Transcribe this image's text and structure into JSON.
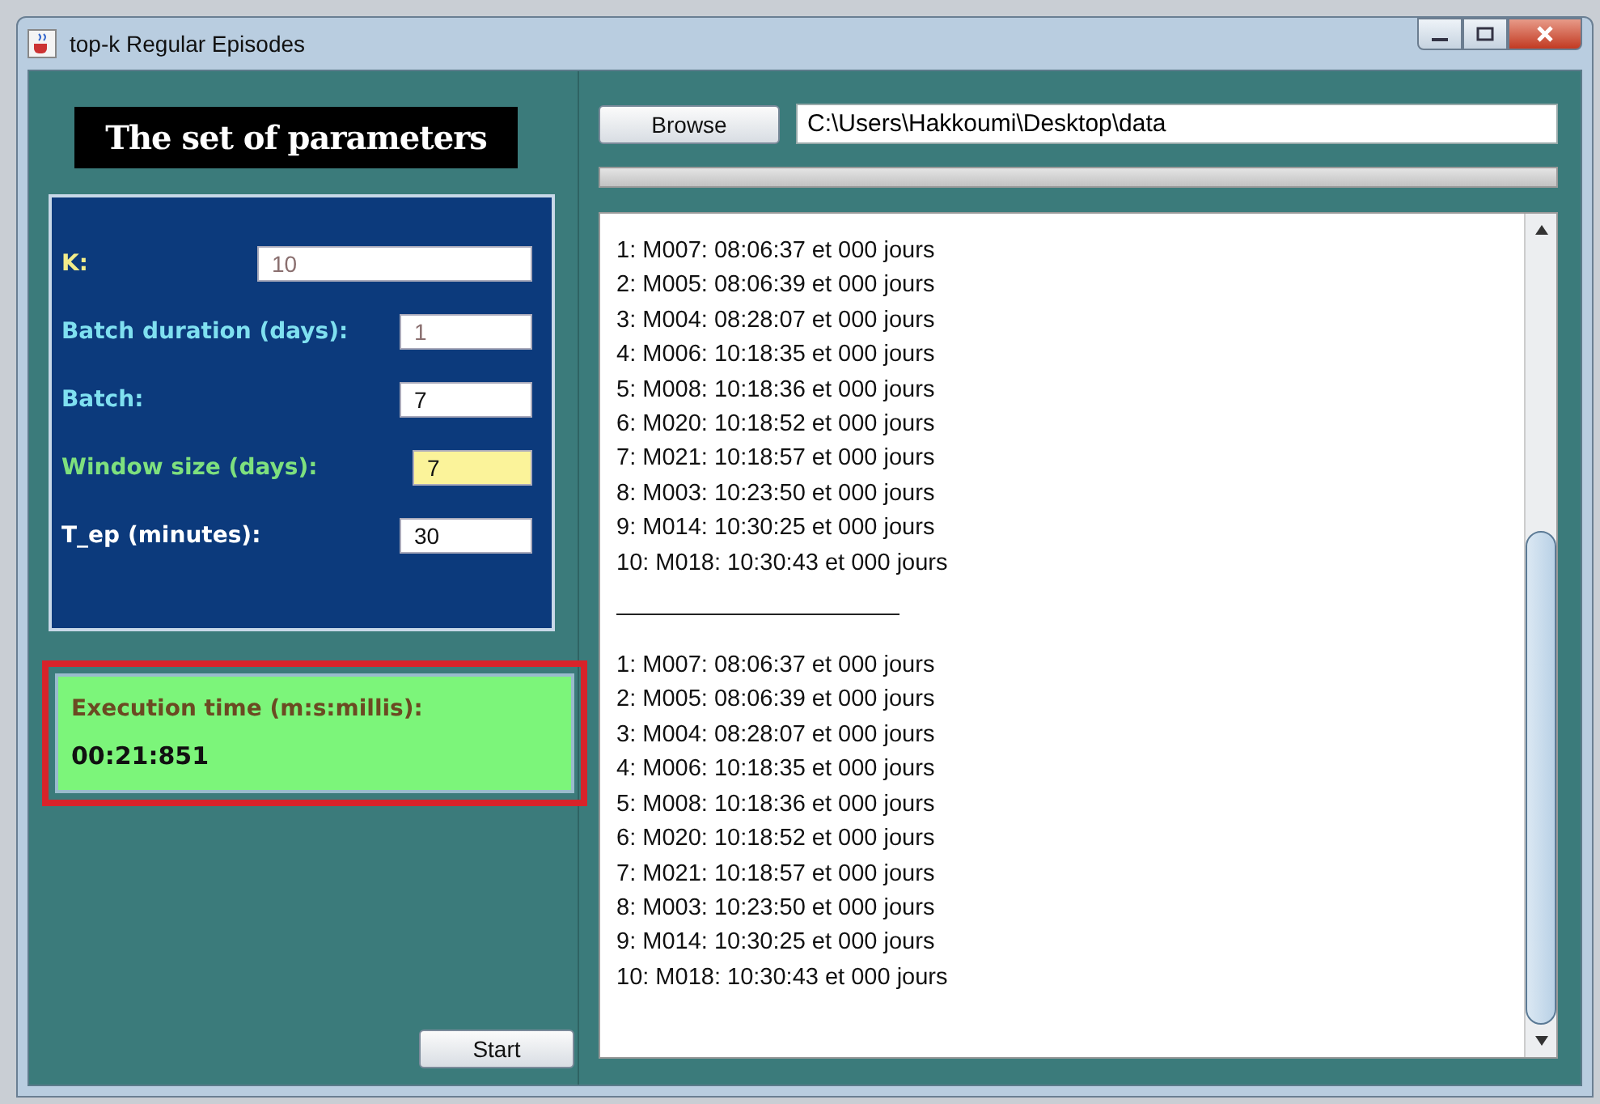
{
  "window": {
    "title": "top-k Regular Episodes"
  },
  "parameters_title": "The set of parameters",
  "parameters": [
    {
      "label": "K:",
      "color": "#f2ec8a",
      "value": "10",
      "disabled": true,
      "highlighted": false
    },
    {
      "label": "Batch duration (days):",
      "color": "#7fe0f0",
      "value": "1",
      "disabled": true,
      "highlighted": false
    },
    {
      "label": "Batch:",
      "color": "#7fe0f0",
      "value": "7",
      "disabled": false,
      "highlighted": false
    },
    {
      "label": "Window size (days):",
      "color": "#7ee07e",
      "value": "7",
      "disabled": false,
      "highlighted": true
    },
    {
      "label": "T_ep (minutes):",
      "color": "#ffffff",
      "value": "30",
      "disabled": false,
      "highlighted": false
    }
  ],
  "execution": {
    "label": "Execution time (m:s:millis):",
    "value": "00:21:851",
    "highlighted": true
  },
  "start_button": "Start",
  "browse_button": "Browse",
  "progress": {
    "level": 1
  },
  "path_field": {
    "value": "C:\\Users\\Hakkoumi\\Desktop\\data"
  },
  "output": [
    {
      "kind": "line",
      "text": "1: M007: 08:06:37 et 000 jours"
    },
    {
      "kind": "line",
      "text": "2: M005: 08:06:39 et 000 jours"
    },
    {
      "kind": "line",
      "text": "3: M004: 08:28:07 et 000 jours"
    },
    {
      "kind": "line",
      "text": "4: M006: 10:18:35 et 000 jours"
    },
    {
      "kind": "line",
      "text": "5: M008: 10:18:36 et 000 jours"
    },
    {
      "kind": "line",
      "text": "6: M020: 10:18:52 et 000 jours"
    },
    {
      "kind": "line",
      "text": "7: M021: 10:18:57 et 000 jours"
    },
    {
      "kind": "line",
      "text": "8: M003: 10:23:50 et 000 jours"
    },
    {
      "kind": "line",
      "text": "9: M014: 10:30:25 et 000 jours"
    },
    {
      "kind": "line",
      "text": "10: M018: 10:30:43 et 000 jours"
    },
    {
      "kind": "separator"
    },
    {
      "kind": "line",
      "text": "1: M007: 08:06:37 et 000 jours"
    },
    {
      "kind": "line",
      "text": "2: M005: 08:06:39 et 000 jours"
    },
    {
      "kind": "line",
      "text": "3: M004: 08:28:07 et 000 jours"
    },
    {
      "kind": "line",
      "text": "4: M006: 10:18:35 et 000 jours"
    },
    {
      "kind": "line",
      "text": "5: M008: 10:18:36 et 000 jours"
    },
    {
      "kind": "line",
      "text": "6: M020: 10:18:52 et 000 jours"
    },
    {
      "kind": "line",
      "text": "7: M021: 10:18:57 et 000 jours"
    },
    {
      "kind": "line",
      "text": "8: M003: 10:23:50 et 000 jours"
    },
    {
      "kind": "line",
      "text": "9: M014: 10:30:25 et 000 jours"
    },
    {
      "kind": "line",
      "text": "10: M018: 10:30:43 et 000 jours"
    }
  ]
}
